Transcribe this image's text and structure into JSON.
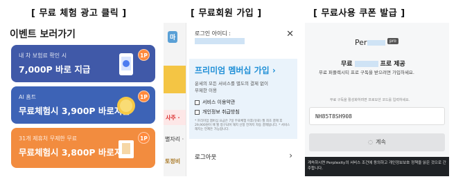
{
  "captions": {
    "free_trial_ad": "[ 무료 체험 광고 클릭 ]",
    "free_membership": "[ 무료회원 가입 ]",
    "free_coupon": "[ 무료사용 쿠폰 발급 ]"
  },
  "events_panel": {
    "title": "이벤트 보러가기",
    "cards": [
      {
        "small": "내 차 보험료 확인 시",
        "big": "7,000P 바로 지급",
        "badge": "1P",
        "color": "#4059a8"
      },
      {
        "small": "AI 홈트",
        "big": "무료체험시 3,900P 바로지급",
        "badge": "1P",
        "color": "#3d63b6"
      },
      {
        "small": "31개 제휴처 무제한 무료",
        "big": "무료체험시 3,800P 바로지급",
        "badge": "1P",
        "color": "#f28c3f"
      }
    ]
  },
  "membership_panel": {
    "strip": {
      "logo": "마",
      "red_text": "사주 ·",
      "text1": "별자리 ·",
      "text2": "토정비"
    },
    "modal": {
      "login_id_label": "로그인 아이디 :",
      "close_icon": "close-icon",
      "premium_title": "프리미엄 멤버십 가입 ›",
      "premium_desc1": "운세의 모든 서비스를 별도의 결제 없이",
      "premium_desc2": "무제한 이용",
      "check_terms": "서비스 이용약관",
      "check_privacy": "개인정보 취급방침",
      "fine_print": "* 프리미엄 멤버십 요금은 7일 무료체험 이후(유료) 월 최초 결제 후 29,900원이 매 월 청구되며 해지 신청 전까지 자동 결제됩니다. * 서비스 해지는 언제든 가능합니다.",
      "logout_label": "로그아웃",
      "logout_chevron": "›"
    }
  },
  "coupon_panel": {
    "logo_text": "Per",
    "logo_badge": "pro",
    "heading_left": "무료",
    "heading_right": "프로 제공",
    "sub": "무료 퍼플렉시티 프로 구독을 받으려면 가입하세요.",
    "hint": "무료 구독을 활성화하려면 프로모션 코드를 입력하세요.",
    "code_value": "NH85T8SH908",
    "continue_label": "계속",
    "footer_text": "계속하시면 Perplexity의 서비스 조건에 동의하고 개인정보보호 정책을 읽은 것으로 간주합니다."
  }
}
